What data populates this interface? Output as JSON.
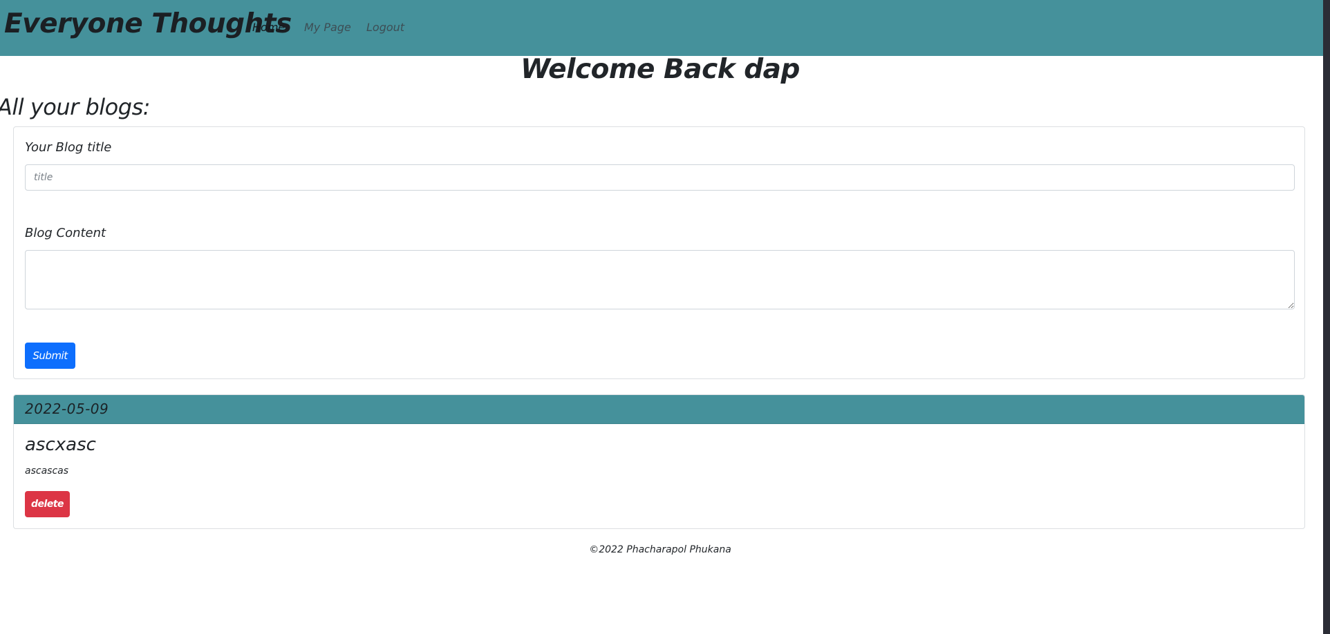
{
  "navbar": {
    "brand": "Everyone Thoughts",
    "links": [
      {
        "label": "Home",
        "active": true
      },
      {
        "label": "My Page",
        "active": false
      },
      {
        "label": "Logout",
        "active": false
      }
    ]
  },
  "welcome": "Welcome Back dap",
  "section_heading": "All your blogs:",
  "form": {
    "title_label": "Your Blog title",
    "title_value": "",
    "title_placeholder": "title",
    "content_label": "Blog Content",
    "content_value": "",
    "submit_label": "Submit"
  },
  "posts": [
    {
      "date": "2022-05-09",
      "title": "ascxasc",
      "content": "ascascas",
      "delete_label": "delete"
    }
  ],
  "footer": "©2022 Phacharapol Phukana",
  "colors": {
    "navbar_bg": "#45919b",
    "submit_button": "#0d6efd",
    "delete_button": "#dc3545"
  }
}
